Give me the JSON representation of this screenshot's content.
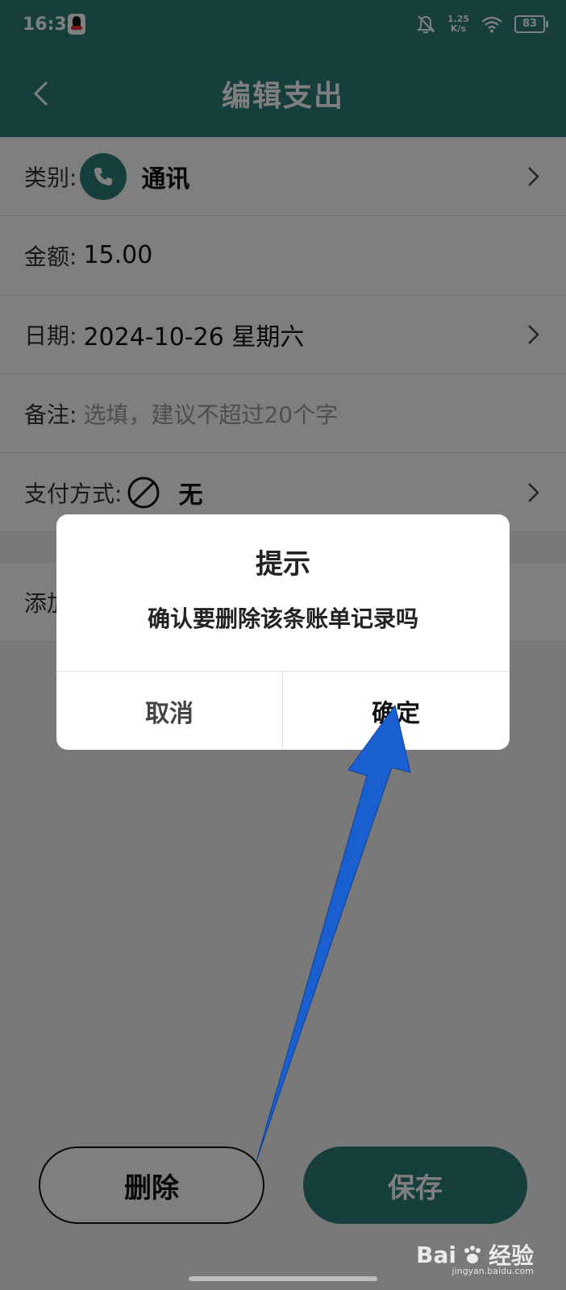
{
  "status": {
    "time": "16:34",
    "net_speed_value": "1.25",
    "net_speed_unit": "K/s",
    "battery": "83"
  },
  "header": {
    "title": "编辑支出"
  },
  "form": {
    "category": {
      "label": "类别:",
      "value": "通讯",
      "icon": "phone-icon"
    },
    "amount": {
      "label": "金额:",
      "value": "15.00"
    },
    "date": {
      "label": "日期:",
      "value": "2024-10-26 星期六"
    },
    "note": {
      "label": "备注:",
      "placeholder": "选填，建议不超过20个字"
    },
    "payment": {
      "label": "支付方式:",
      "value": "无",
      "icon": "none-icon"
    },
    "extra": {
      "label": "添加"
    }
  },
  "buttons": {
    "delete": "删除",
    "save": "保存"
  },
  "dialog": {
    "title": "提示",
    "message": "确认要删除该条账单记录吗",
    "cancel": "取消",
    "confirm": "确定"
  },
  "watermark": {
    "brand": "Bai",
    "suffix": "经验",
    "url": "jingyan.baidu.com"
  },
  "colors": {
    "accent": "#2b7d7b",
    "annotation_arrow": "#1a5fd0"
  }
}
